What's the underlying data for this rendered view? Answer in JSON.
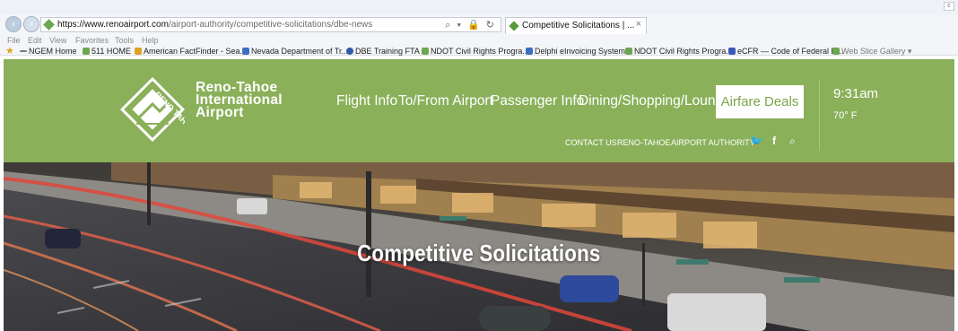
{
  "browser": {
    "url_host": "https://www.renoairport.com",
    "url_path": "/airport-authority/competitive-solicitations/dbe-news",
    "address_tools": "⌕ ▾ 🔒 ↻",
    "tab_title": "Competitive Solicitations | ...",
    "tab_close": "×",
    "corner_button": "c",
    "back_icon": "back-arrow-icon",
    "forward_icon": "forward-arrow-icon",
    "menu": [
      "File",
      "Edit",
      "View",
      "Favorites",
      "Tools",
      "Help"
    ],
    "favorites": [
      {
        "label": "NGEM Home",
        "color": "#7b7b7b"
      },
      {
        "label": "511 HOME",
        "color": "#6aa84f"
      },
      {
        "label": "American FactFinder - Sea...",
        "color": "#e0a020"
      },
      {
        "label": "Nevada Department of Tr...",
        "color": "#3b6fc4"
      },
      {
        "label": "DBE Training  FTA",
        "color": "#2f5aa8"
      },
      {
        "label": "NDOT Civil Rights Progra...",
        "color": "#6aa84f"
      },
      {
        "label": "Delphi eInvoicing System",
        "color": "#3b6fc4"
      },
      {
        "label": "NDOT Civil Rights Progra...",
        "color": "#6aa84f"
      },
      {
        "label": "eCFR — Code of Federal R...",
        "color": "#3b58b8"
      },
      {
        "label": "Web Slice Gallery ▾",
        "color": "#6aa84f"
      }
    ]
  },
  "header": {
    "logo_lines": [
      "Reno-Tahoe",
      "International",
      "Airport"
    ],
    "logo_mark_text": "RENO TAHOE",
    "nav": [
      "Flight Info",
      "To/From Airport",
      "Passenger Info",
      "Dining/Shopping/Lounge"
    ],
    "cta": "Airfare Deals",
    "time": "9:31am",
    "temperature": "70° F",
    "subnav": [
      "CONTACT US",
      "RENO-TAHOE",
      "AIRPORT AUTHORITY"
    ],
    "social": {
      "twitter": "🐦",
      "facebook": "f",
      "search": "⌕"
    },
    "brand_color": "#8ab05a"
  },
  "hero": {
    "title": "Competitive Solicitations"
  }
}
